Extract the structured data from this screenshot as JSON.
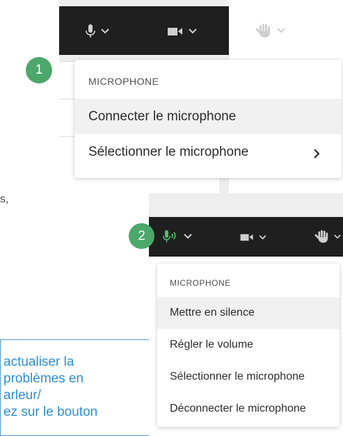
{
  "step_badges": [
    "1",
    "2"
  ],
  "left_text_fragment": "s,",
  "callout_lines": [
    "actualiser la",
    "problèmes en",
    "arleur/",
    "ez sur le bouton"
  ],
  "toolbar": {
    "icons": [
      "microphone-icon",
      "chevron-down-icon",
      "camera-icon",
      "raise-hand-icon"
    ],
    "active_mic_color": "#4cc26a"
  },
  "menu1": {
    "header": "MICROPHONE",
    "items": [
      "Connecter le microphone",
      "Sélectionner le microphone"
    ],
    "submenu_arrow": "›"
  },
  "menu2": {
    "header": "MICROPHONE",
    "items": [
      "Mettre en silence",
      "Régler le volume",
      "Sélectionner le microphone",
      "Déconnecter le microphone"
    ]
  },
  "colors": {
    "toolbar": "#1f1f1f",
    "badge": "#4ca76a",
    "callout": "#2f8ed8"
  }
}
